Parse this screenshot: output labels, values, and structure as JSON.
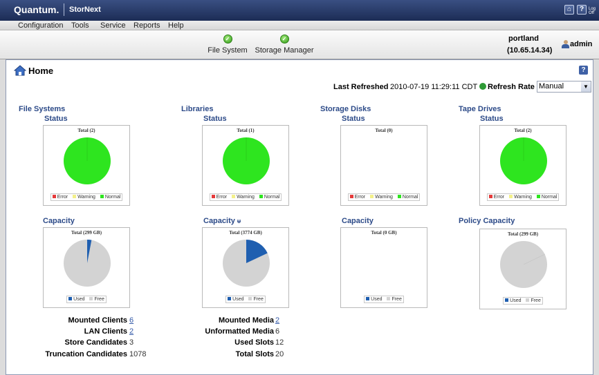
{
  "titlebar": {
    "brand": "Quantum.",
    "product": "StorNext",
    "home_button_icon": "home-icon",
    "help_button": "?",
    "logoff_label": "Log Off"
  },
  "menu": [
    "Configuration",
    "Tools",
    "Service",
    "Reports",
    "Help"
  ],
  "toolbar": {
    "tools": [
      {
        "label": "File System",
        "status": "ok"
      },
      {
        "label": "Storage Manager",
        "status": "ok"
      }
    ],
    "server_name": "portland",
    "server_ip": "(10.65.14.34)",
    "user": "admin"
  },
  "page": {
    "title": "Home",
    "help": "?",
    "last_refreshed_label": "Last Refreshed",
    "last_refreshed_value": "2010-07-19 11:29:11 CDT",
    "refresh_rate_label": "Refresh Rate",
    "refresh_rate_value": "Manual"
  },
  "colors": {
    "error": "#e53a3a",
    "warning": "#f3f08a",
    "normal": "#2ee51f",
    "used": "#1f5fb0",
    "free": "#d3d3d3",
    "heading": "#2c4a88",
    "link": "#3359a8"
  },
  "sections": [
    {
      "title": "File Systems",
      "status": {
        "label": "Status",
        "total": "Total (2)",
        "error": 0,
        "warning": 0,
        "normal": 2
      },
      "capacity": {
        "label": "Capacity",
        "total": "Total (299 GB)",
        "used_fraction": 0.03
      }
    },
    {
      "title": "Libraries",
      "status": {
        "label": "Status",
        "total": "Total (1)",
        "error": 0,
        "warning": 0,
        "normal": 1
      },
      "capacity": {
        "label": "Capacity",
        "total": "Total (3774 GB)",
        "used_fraction": 0.18
      }
    },
    {
      "title": "Storage Disks",
      "status": {
        "label": "Status",
        "total": "Total (0)",
        "error": 0,
        "warning": 0,
        "normal": 0
      },
      "capacity": {
        "label": "Capacity",
        "total": "Total (0 GB)",
        "used_fraction": 0
      }
    },
    {
      "title": "Tape Drives",
      "status": {
        "label": "Status",
        "total": "Total (2)",
        "error": 0,
        "warning": 0,
        "normal": 2
      },
      "capacity": {
        "label": "Policy Capacity",
        "total": "Total (299 GB)",
        "used_fraction": 0
      }
    }
  ],
  "legend": {
    "error": "Error",
    "warning": "Warning",
    "normal": "Normal",
    "used": "Used",
    "free": "Free"
  },
  "fs_stats": [
    {
      "label": "Mounted Clients",
      "value": "6",
      "link": true
    },
    {
      "label": "LAN Clients",
      "value": "2",
      "link": true
    },
    {
      "label": "Store Candidates",
      "value": "3",
      "link": false
    },
    {
      "label": "Truncation Candidates",
      "value": "1078",
      "link": false
    }
  ],
  "lib_stats": [
    {
      "label": "Mounted Media",
      "value": "2",
      "link": true
    },
    {
      "label": "Unformatted Media",
      "value": "6",
      "link": false
    },
    {
      "label": "Used Slots",
      "value": "12",
      "link": false
    },
    {
      "label": "Total Slots",
      "value": "20",
      "link": false
    }
  ]
}
